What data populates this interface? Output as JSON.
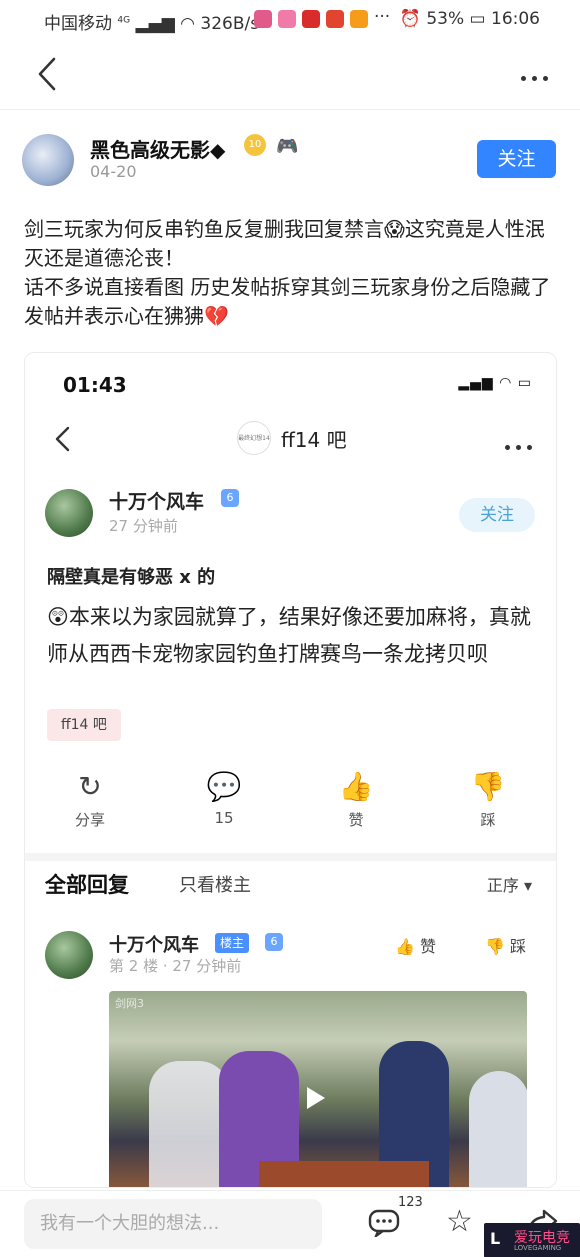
{
  "status_bar": {
    "carrier": "中国移动",
    "network": "4G",
    "speed": "326B/s",
    "battery": "53%",
    "time": "16:06",
    "app_icon_colors": [
      "#e05a8a",
      "#f07aa8",
      "#d92b2b",
      "#e2452f",
      "#f59c1a"
    ]
  },
  "nav": {
    "back_icon": "chevron-left-icon",
    "more_icon": "more-dots-icon"
  },
  "post": {
    "author": "黑色高级无影◆",
    "level_badge": "10",
    "date": "04-20",
    "follow_label": "关注",
    "text_line1": "剑三玩家为何反串钓鱼反复删我回复禁言😱这究竟是人性泯灭还是道德沦丧！",
    "text_line2": "话不多说直接看图 历史发帖拆穿其剑三玩家身份之后隐藏了发帖并表示心在狒狒💔"
  },
  "screenshot": {
    "time": "01:43",
    "forum_logo": "最终幻想14",
    "forum_title": "ff14 吧",
    "author": "十万个风车",
    "badge": "6",
    "post_time": "27 分钟前",
    "follow_label": "关注",
    "post_title": "隔壁真是有够恶 x 的",
    "post_body": "😲本来以为家园就算了，结果好像还要加麻将，真就师从西西卡宠物家园钓鱼打牌赛鸟一条龙拷贝呗",
    "tag": "ff14 吧",
    "actions": [
      {
        "label": "分享",
        "icon": "share-icon"
      },
      {
        "label": "15",
        "icon": "comment-icon"
      },
      {
        "label": "赞",
        "icon": "thumbs-up-icon"
      },
      {
        "label": "踩",
        "icon": "thumbs-down-icon"
      }
    ],
    "replies_header": "全部回复",
    "only_host": "只看楼主",
    "sort": "正序",
    "reply": {
      "author": "十万个风车",
      "owner_tag": "楼主",
      "badge": "6",
      "meta": "第 2 楼 · 27 分钟前",
      "like": "赞",
      "dislike": "踩"
    }
  },
  "bottom_bar": {
    "input_placeholder": "我有一个大胆的想法...",
    "comment_count": "123"
  }
}
